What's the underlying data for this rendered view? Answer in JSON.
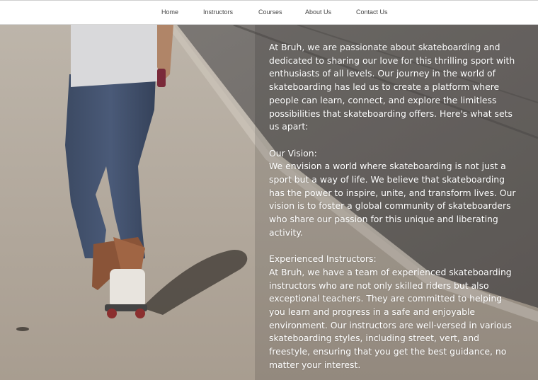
{
  "nav": {
    "items": [
      {
        "label": "Home"
      },
      {
        "label": "Instructors"
      },
      {
        "label": "Courses"
      },
      {
        "label": "About Us"
      },
      {
        "label": "Contact Us"
      }
    ]
  },
  "about": {
    "intro": "At Bruh, we are passionate about skateboarding and dedicated to sharing our love for this thrilling sport with enthusiasts of all levels. Our journey in the world of skateboarding has led us to create a platform where people can learn, connect, and explore the limitless possibilities that skateboarding offers. Here's what sets us apart:",
    "sections": [
      {
        "heading": "Our Vision:",
        "body": "We envision a world where skateboarding is not just a sport but a way of life. We believe that skateboarding has the power to inspire, unite, and transform lives. Our vision is to foster a global community of skateboarders who share our passion for this unique and liberating activity."
      },
      {
        "heading": "Experienced Instructors:",
        "body": "At Bruh, we have a team of experienced skateboarding instructors who are not only skilled riders but also exceptional teachers. They are committed to helping you learn and progress in a safe and enjoyable environment. Our instructors are well-versed in various skateboarding styles, including street, vert, and freestyle, ensuring that you get the best guidance, no matter your interest."
      }
    ]
  },
  "colors": {
    "nav_background": "#ffffff",
    "nav_text": "#444444",
    "body_text": "#ffffff"
  }
}
